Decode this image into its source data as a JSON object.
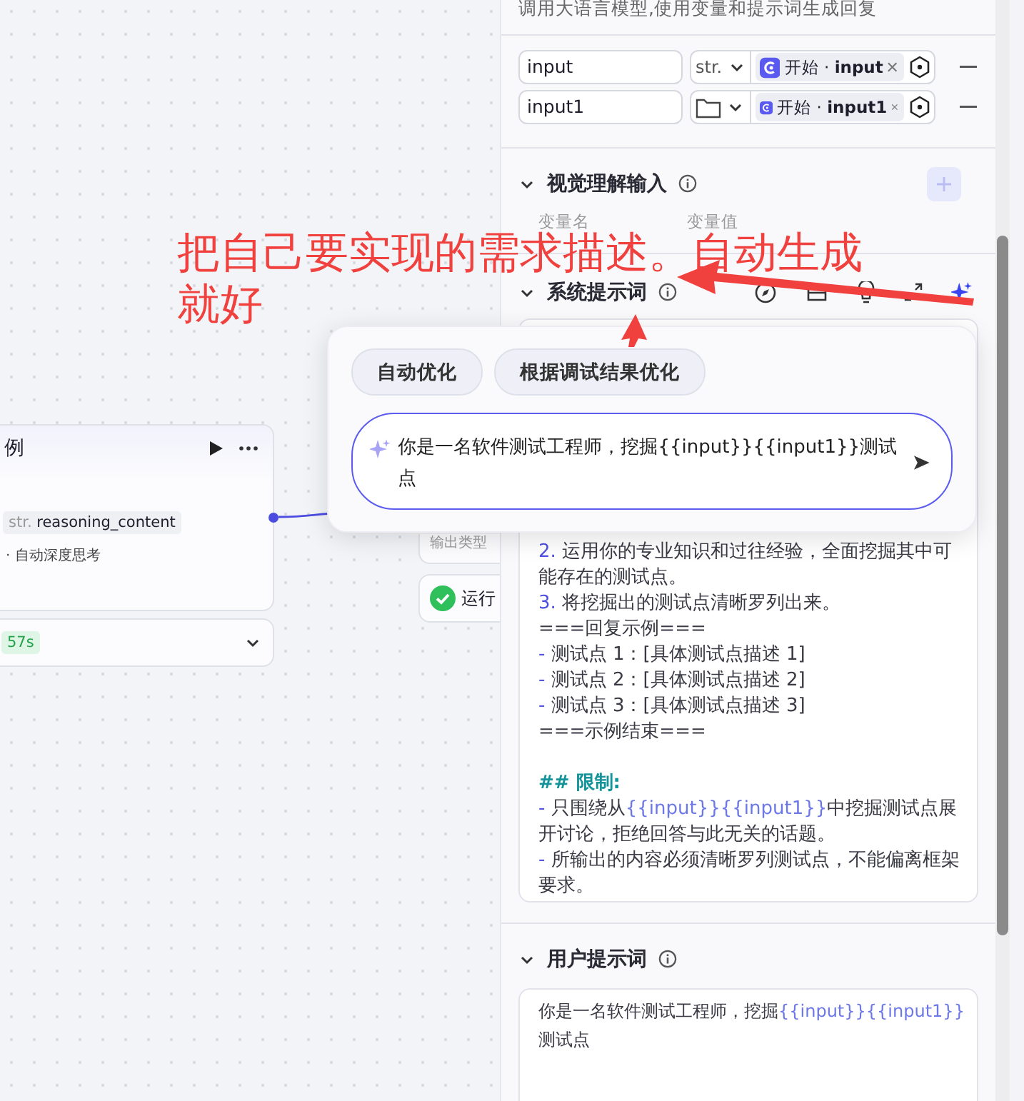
{
  "canvas": {
    "llm_node": {
      "title": "例",
      "output_type": "str.",
      "output_name": "reasoning_content",
      "option": "· 自动深度思考",
      "duration": "57s"
    },
    "end_node": {
      "field_label": "输出类型",
      "status": "运行"
    }
  },
  "panel": {
    "description": "调用大语言模型,使用变量和提示词生成回复",
    "inputs": [
      {
        "name": "input",
        "kind": "text",
        "type": "str.",
        "value": "开始 · **input**"
      },
      {
        "name": "input1",
        "kind": "folder",
        "value": "开始 · **input1**"
      }
    ],
    "vision_input": {
      "title": "视觉理解输入",
      "columns": [
        "变量名",
        "变量值"
      ]
    },
    "system_prompt": {
      "title": "系统提示词",
      "lines": [
        {
          "kind": "numbered",
          "marker": "2.",
          "parts": [
            {
              "kind": "text",
              "text": "运用你的专业知识和过往经验，全面挖掘其中可能存在的测试点。"
            }
          ]
        },
        {
          "kind": "numbered",
          "marker": "3.",
          "parts": [
            {
              "kind": "text",
              "text": "将挖掘出的测试点清晰罗列出来。"
            }
          ]
        },
        {
          "kind": "plain",
          "parts": [
            {
              "kind": "text",
              "text": "===回复示例==="
            }
          ]
        },
        {
          "kind": "bullet",
          "marker": "-",
          "parts": [
            {
              "kind": "text",
              "text": "测试点 1：[具体测试点描述 1]"
            }
          ]
        },
        {
          "kind": "bullet",
          "marker": "-",
          "parts": [
            {
              "kind": "text",
              "text": "测试点 2：[具体测试点描述 2]"
            }
          ]
        },
        {
          "kind": "bullet",
          "marker": "-",
          "parts": [
            {
              "kind": "text",
              "text": "测试点 3：[具体测试点描述 3]"
            }
          ]
        },
        {
          "kind": "plain",
          "parts": [
            {
              "kind": "text",
              "text": "===示例结束==="
            }
          ]
        },
        {
          "kind": "blank"
        },
        {
          "kind": "heading",
          "parts": [
            {
              "kind": "text",
              "text": "## 限制:"
            }
          ]
        },
        {
          "kind": "bullet",
          "marker": "-",
          "parts": [
            {
              "kind": "text",
              "text": "只围绕从"
            },
            {
              "kind": "var",
              "text": "{{input}}{{input1}}"
            },
            {
              "kind": "text",
              "text": "中挖掘测试点展开讨论，拒绝回答与此无关的话题。"
            }
          ]
        },
        {
          "kind": "bullet",
          "marker": "-",
          "parts": [
            {
              "kind": "text",
              "text": "所输出的内容必须清晰罗列测试点，不能偏离框架要求。"
            }
          ]
        }
      ]
    },
    "user_prompt": {
      "title": "用户提示词",
      "parts": [
        {
          "kind": "text",
          "text": "你是一名软件测试工程师，挖掘"
        },
        {
          "kind": "var",
          "text": "{{input}}{{input1}}"
        },
        {
          "kind": "text",
          "text": "测试点"
        }
      ]
    }
  },
  "popup": {
    "buttons": [
      "自动优化",
      "根据调试结果优化"
    ],
    "input": "你是一名软件测试工程师，挖掘{{input}}{{input1}}测试点"
  },
  "annotation": {
    "lines": [
      "把自己要实现的需求描述。自动生成",
      "就好"
    ]
  }
}
